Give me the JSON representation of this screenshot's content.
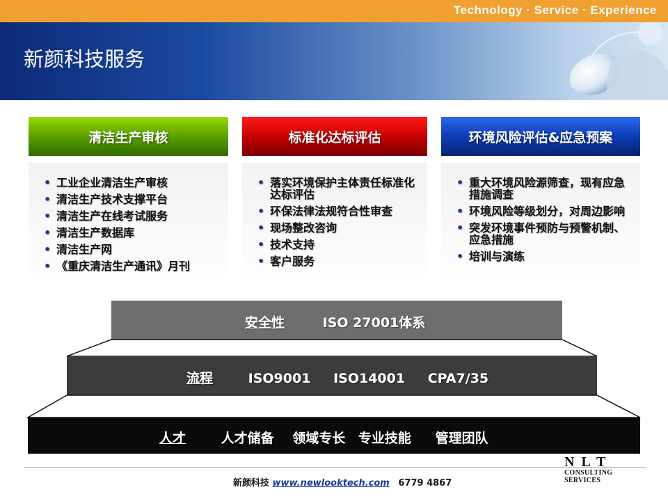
{
  "header": {
    "tagline": "Technology · Service · Experience",
    "title": "新颜科技服务"
  },
  "cards": [
    {
      "title": "清洁生产审核",
      "items": [
        "工业企业清洁生产审核",
        "清洁生产技术支撑平台",
        "清洁生产在线考试服务",
        "清洁生产数据库",
        "清洁生产网",
        "《重庆清洁生产通讯》月刊"
      ]
    },
    {
      "title": "标准化达标评估",
      "items": [
        "落实环境保护主体责任标准化达标评估",
        "环保法律法规符合性审查",
        "现场整改咨询",
        "技术支持",
        "客户服务"
      ]
    },
    {
      "title": "环境风险评估&应急预案",
      "items": [
        "重大环境风险源筛查，现有应急措施调查",
        "环境风险等级划分，对周边影响",
        "突发环境事件预防与预警机制、应急措施",
        "培训与演练"
      ]
    }
  ],
  "pyramid": {
    "top": {
      "label": "安全性",
      "items": [
        "ISO 27001体系"
      ]
    },
    "middle": {
      "label": "流程",
      "items": [
        "ISO9001",
        "ISO14001",
        "CPA7/35"
      ]
    },
    "bottom": {
      "label": "人才",
      "items": [
        "人才储备",
        "领域专长",
        "专业技能",
        "管理团队"
      ]
    }
  },
  "colors": {
    "top_bar": "#f0a030",
    "green_header": "#5aa000",
    "red_header": "#c80000",
    "blue_header": "#0d3cb8",
    "pyramid_top": "#6e6e6e",
    "pyramid_middle": "#3c3c3c",
    "pyramid_bottom": "#0a0a0a"
  },
  "footer": {
    "company": "新颜科技",
    "url": "www.newlooktech.com",
    "phone": "6779 4867",
    "logo_main": "NLT",
    "logo_line1": "CONSULTING",
    "logo_line2": "SERVICES"
  }
}
